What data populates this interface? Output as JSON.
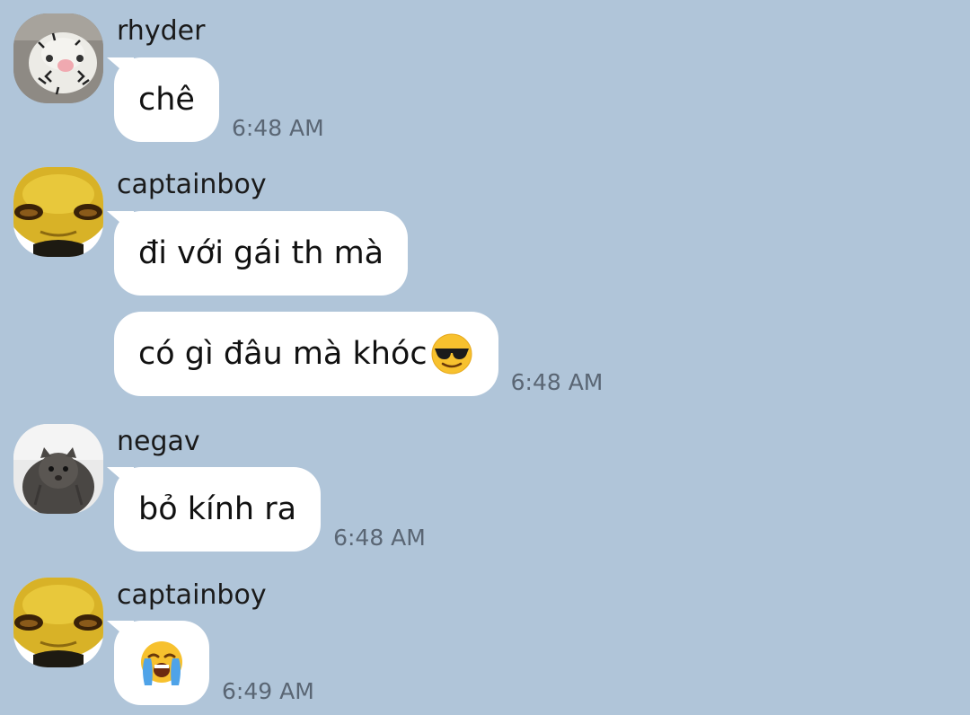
{
  "messages": [
    {
      "sender": "rhyder",
      "avatar_icon": "cat-face-avatar",
      "bubbles": [
        {
          "text": "chê",
          "time": "6:48 AM"
        }
      ]
    },
    {
      "sender": "captainboy",
      "avatar_icon": "yellow-creature-avatar",
      "bubbles": [
        {
          "text": "đi với gái th mà",
          "time": ""
        },
        {
          "text": "có gì đâu mà khóc",
          "emoji": "smiling-face-with-sunglasses-emoji",
          "time": "6:48 AM"
        }
      ]
    },
    {
      "sender": "negav",
      "avatar_icon": "wet-cat-avatar",
      "bubbles": [
        {
          "text": "bỏ kính ra",
          "time": "6:48 AM"
        }
      ]
    },
    {
      "sender": "captainboy",
      "avatar_icon": "yellow-creature-avatar",
      "bubbles": [
        {
          "text": "",
          "emoji": "loudly-crying-face-emoji",
          "time": "6:49 AM"
        }
      ]
    }
  ],
  "colors": {
    "background": "#b0c5d9",
    "bubble": "#ffffff",
    "timestamp": "#5a6674"
  }
}
